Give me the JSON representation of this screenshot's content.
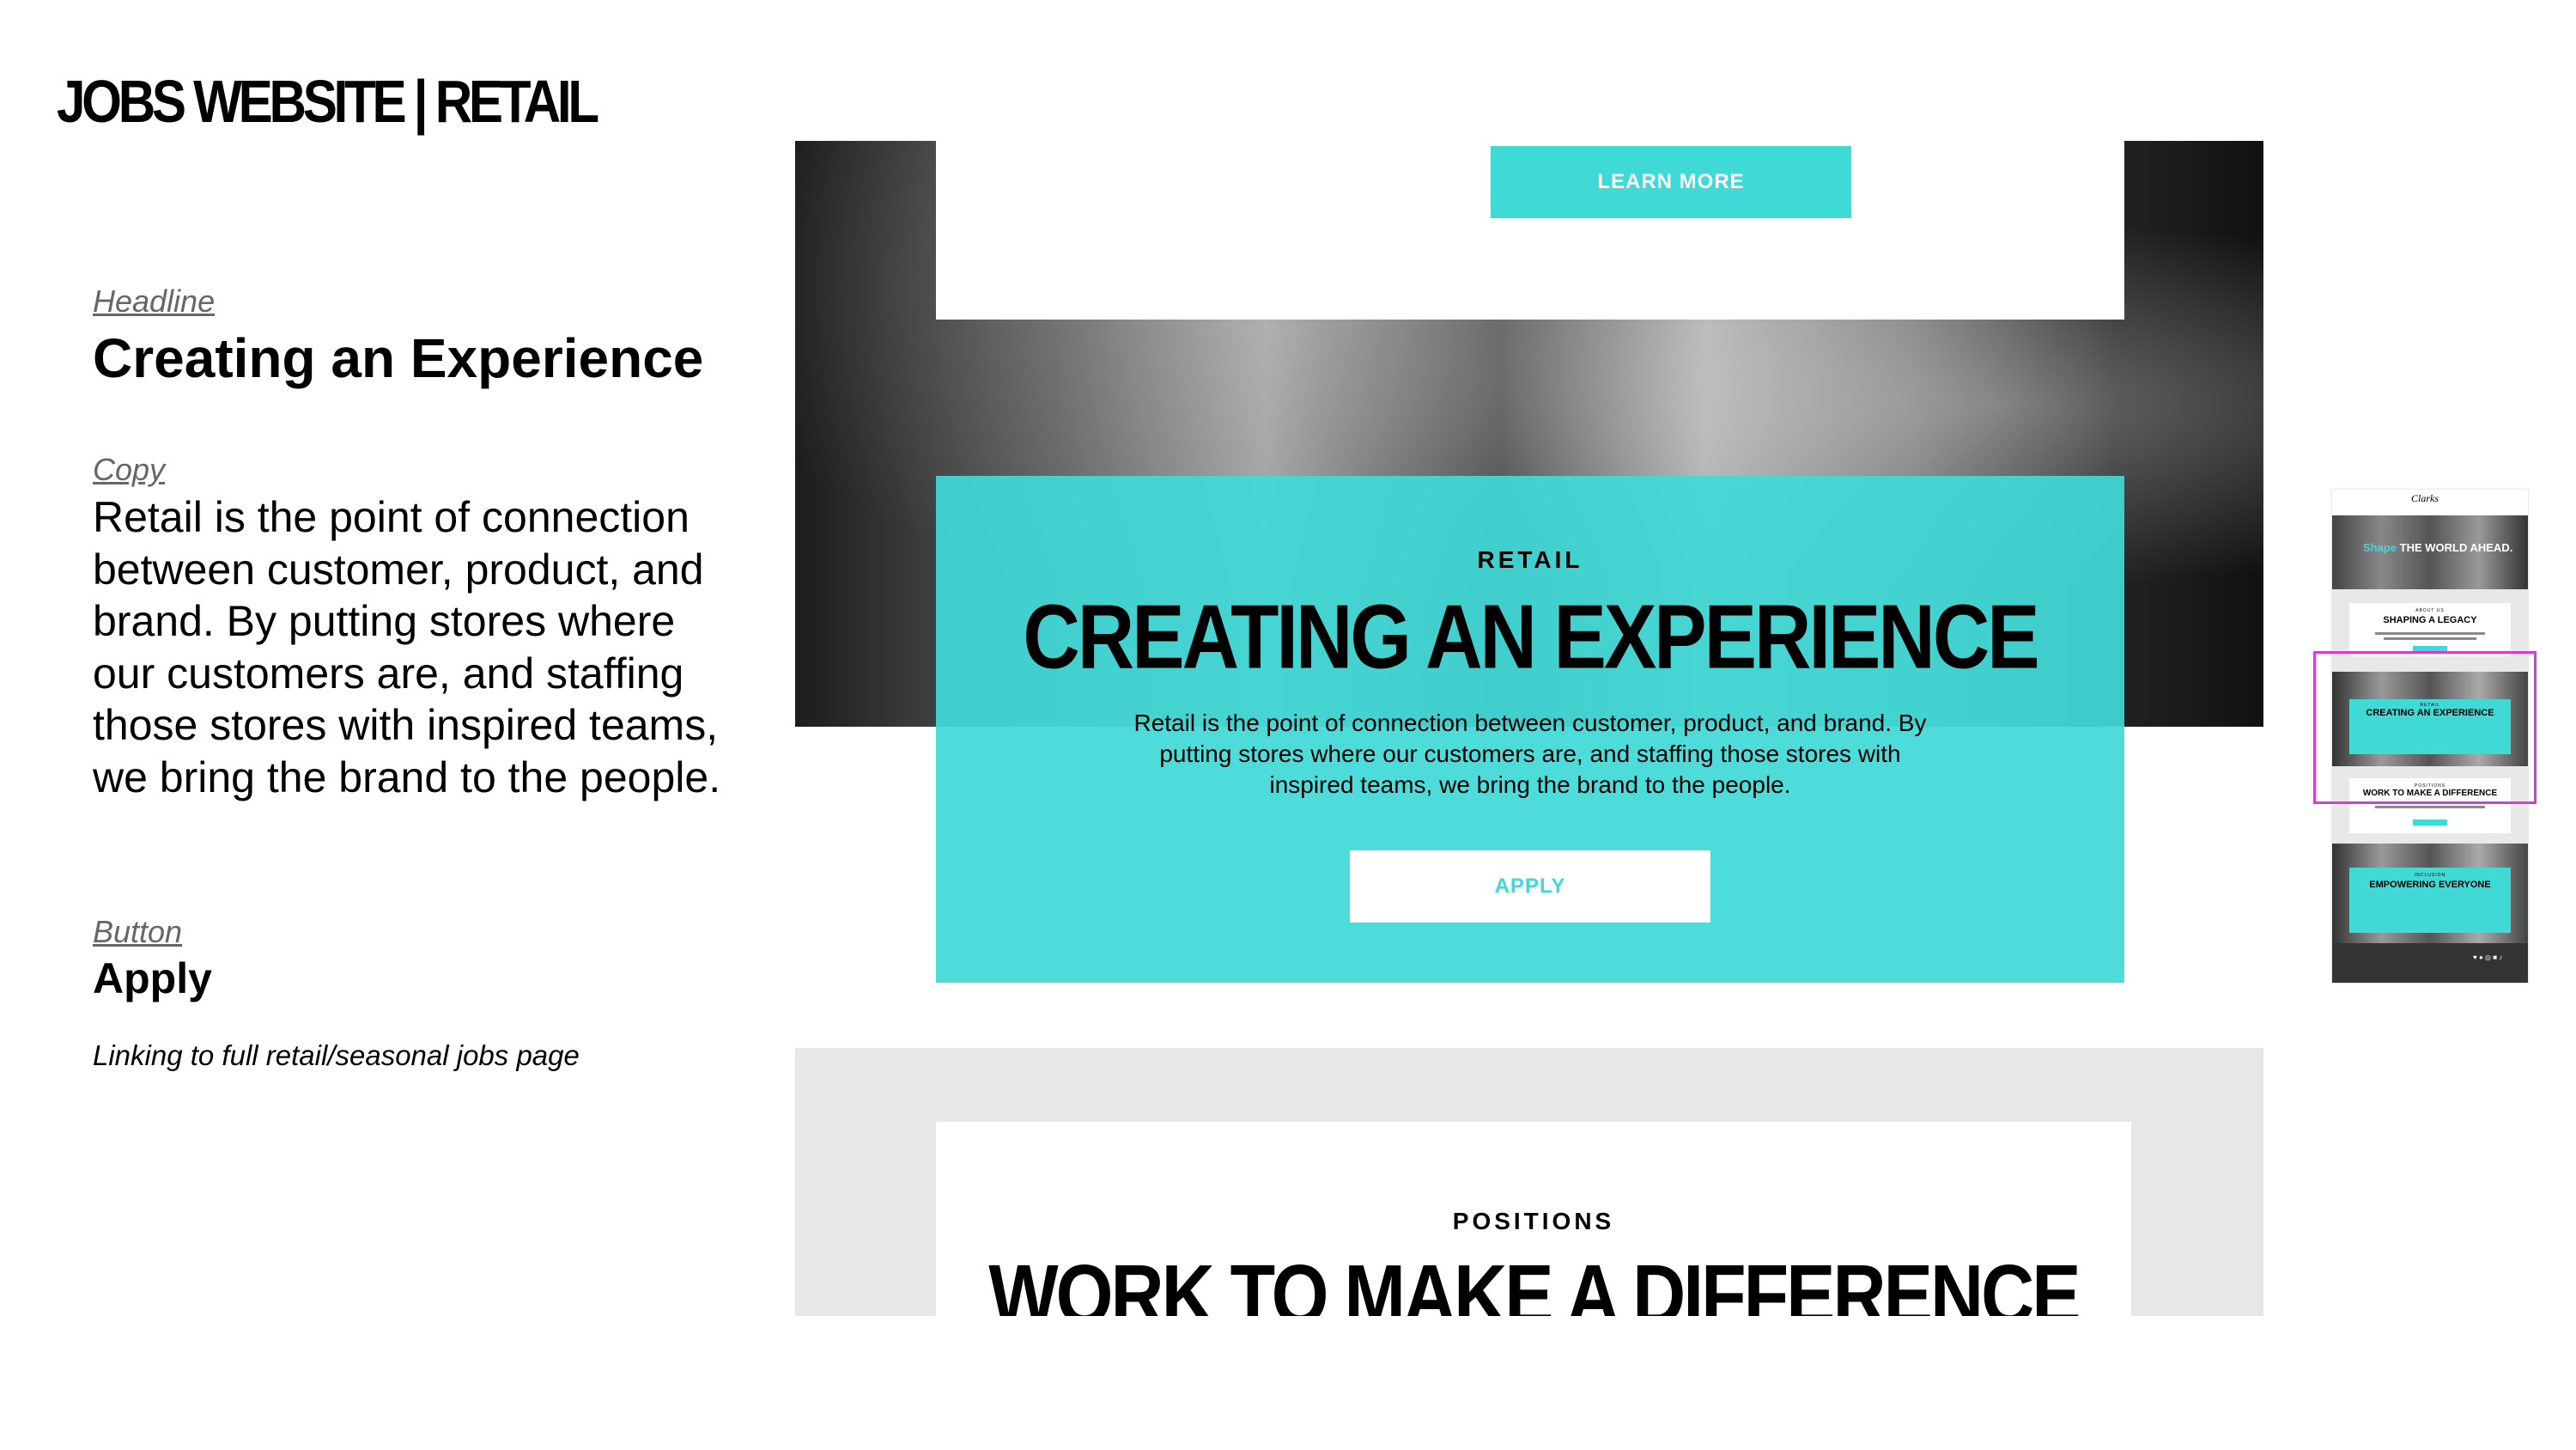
{
  "slide_title": "JOBS WEBSITE | RETAIL",
  "annotations": {
    "headline_label": "Headline",
    "headline": "Creating an Experience",
    "copy_label": "Copy",
    "copy": "Retail is the point of connection between customer, product, and brand. By putting stores where our customers are, and staffing those stores with inspired teams, we bring the brand to the people.",
    "button_label": "Button",
    "button": "Apply",
    "note": "Linking to full retail/seasonal jobs page"
  },
  "mockup": {
    "learn_more": "LEARN MORE",
    "eyebrow": "RETAIL",
    "headline": "CREATING AN EXPERIENCE",
    "body": "Retail is the point of connection between customer, product, and brand. By putting stores where our customers are, and staffing those stores with inspired teams, we bring the brand to the people.",
    "apply": "APPLY",
    "positions_eyebrow": "POSITIONS",
    "positions_headline": "WORK TO MAKE A DIFFERENCE"
  },
  "thumbnail": {
    "logo": "Clarks",
    "hero_accent": "Shape",
    "hero_text": "THE WORLD AHEAD.",
    "section1_eyebrow": "ABOUT US",
    "section1_head": "SHAPING A LEGACY",
    "section2_eyebrow": "RETAIL",
    "section2_head": "CREATING AN EXPERIENCE",
    "section3_eyebrow": "POSITIONS",
    "section3_head": "WORK TO MAKE A DIFFERENCE",
    "section4_eyebrow": "INCLUSION",
    "section4_head": "EMPOWERING EVERYONE",
    "social": "♥ ● ◎ ■ ♪"
  },
  "colors": {
    "accent_teal": "#3fd9d6",
    "viewport_magenta": "#d83ad8"
  }
}
